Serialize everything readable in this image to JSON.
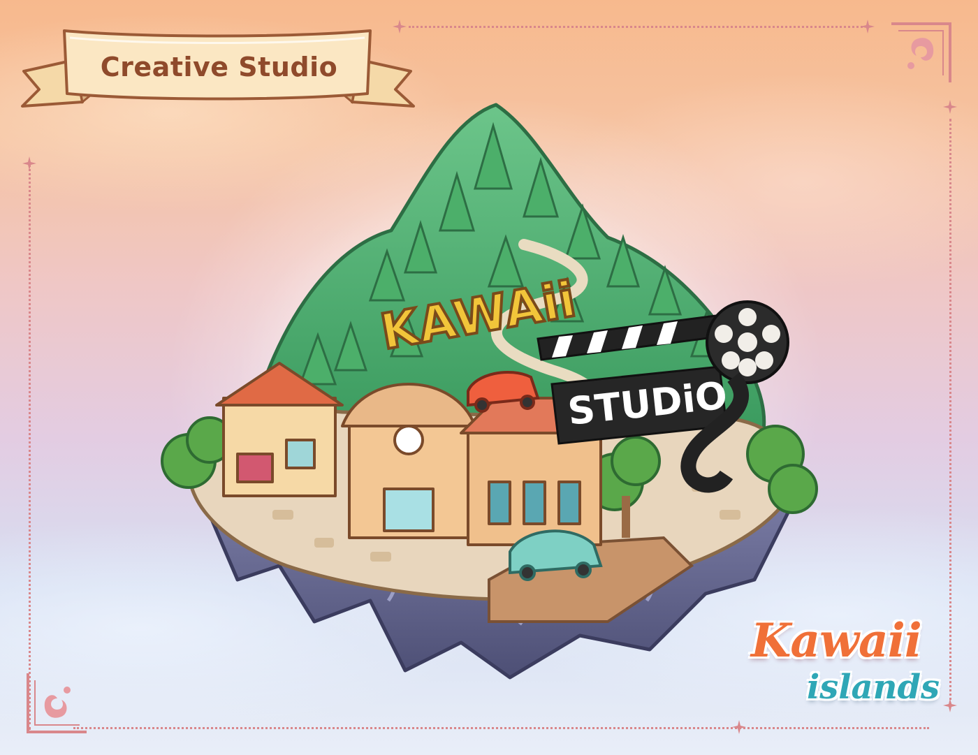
{
  "banner": {
    "title": "Creative Studio"
  },
  "island": {
    "sign_top": "KAWAii",
    "sign_bottom": "STUDiO"
  },
  "logo": {
    "line1": "Kawaii",
    "line2": "islands"
  },
  "colors": {
    "frame": "#d9878b",
    "banner_text": "#8f4a2b",
    "banner_ribbon": "#fbe7c3",
    "logo_orange": "#f07038",
    "logo_teal": "#2fa7b6"
  }
}
